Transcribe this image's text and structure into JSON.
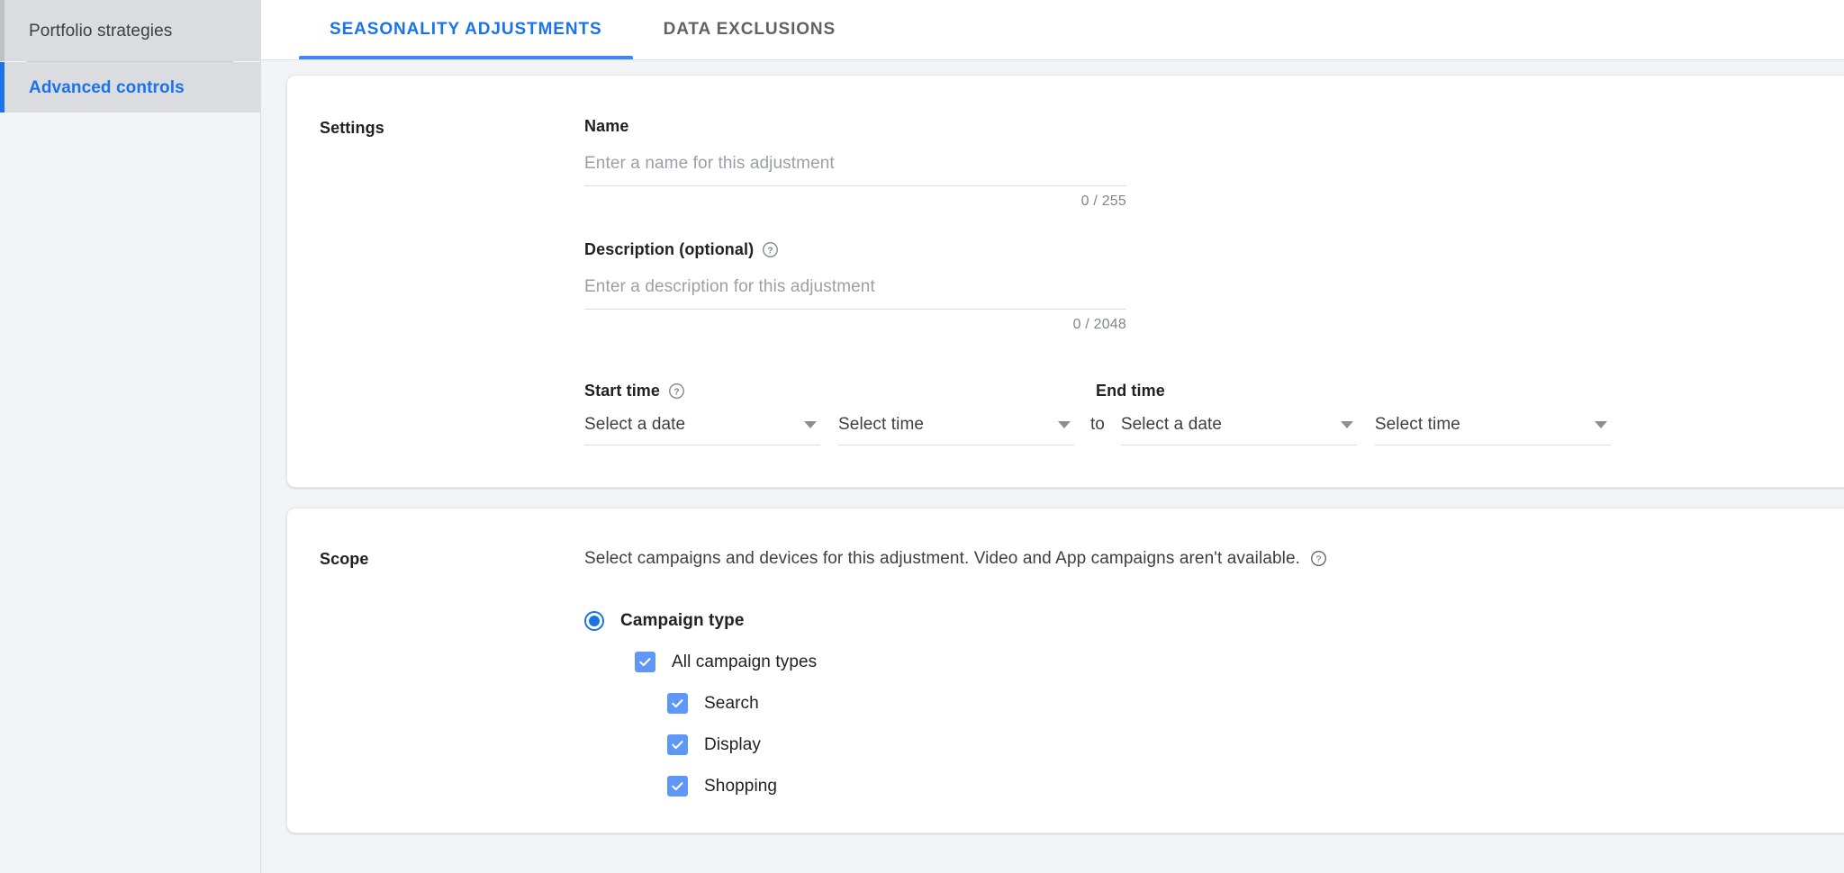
{
  "sidebar": {
    "items": [
      {
        "label": "Portfolio strategies",
        "active": false
      },
      {
        "label": "Advanced controls",
        "active": true
      }
    ]
  },
  "tabs": [
    {
      "label": "SEASONALITY ADJUSTMENTS",
      "active": true
    },
    {
      "label": "DATA EXCLUSIONS",
      "active": false
    }
  ],
  "settings_card": {
    "section_label": "Settings",
    "name": {
      "label": "Name",
      "placeholder": "Enter a name for this adjustment",
      "value": "",
      "counter": "0 / 255"
    },
    "description": {
      "label": "Description (optional)",
      "has_help_icon": true,
      "placeholder": "Enter a description for this adjustment",
      "value": "",
      "counter": "0 / 2048"
    },
    "start_time": {
      "label": "Start time",
      "has_help_icon": true,
      "date_placeholder": "Select a date",
      "time_placeholder": "Select time"
    },
    "to_label": "to",
    "end_time": {
      "label": "End time",
      "has_help_icon": false,
      "date_placeholder": "Select a date",
      "time_placeholder": "Select time"
    }
  },
  "scope_card": {
    "section_label": "Scope",
    "description": "Select campaigns and devices for this adjustment. Video and App campaigns aren't available.",
    "has_help_icon": true,
    "radio": {
      "label": "Campaign type",
      "selected": true
    },
    "checkboxes": [
      {
        "label": "All campaign types",
        "checked": true,
        "indent": 0
      },
      {
        "label": "Search",
        "checked": true,
        "indent": 1
      },
      {
        "label": "Display",
        "checked": true,
        "indent": 1
      },
      {
        "label": "Shopping",
        "checked": true,
        "indent": 1
      }
    ]
  },
  "colors": {
    "accent_blue": "#1a73e8",
    "tab_underline": "#4285f4",
    "checkbox_blue": "#5e97f6",
    "sidebar_bg": "#f1f3f4",
    "sidebar_item_bg": "#dadce0",
    "content_bg": "#f1f3f4",
    "text_primary": "#202124",
    "text_secondary": "#5f6368",
    "placeholder": "#9aa0a6"
  }
}
